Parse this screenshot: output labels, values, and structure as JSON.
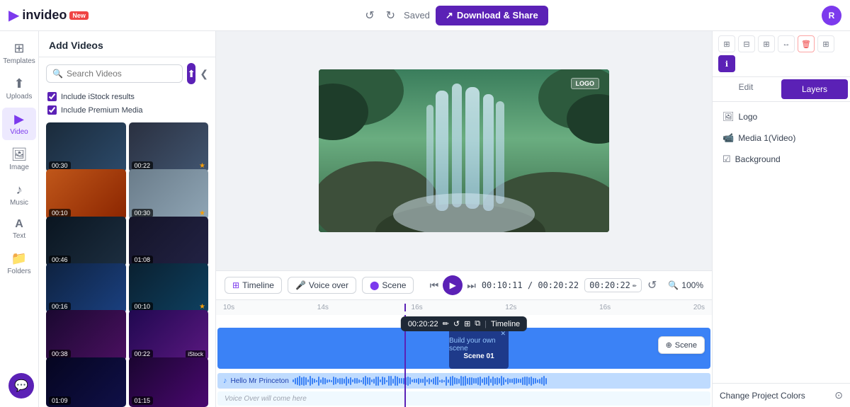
{
  "topbar": {
    "logo_text": "invideo",
    "new_badge": "New",
    "saved_label": "Saved",
    "download_btn": "Download & Share",
    "avatar_initial": "R"
  },
  "left_sidebar": {
    "items": [
      {
        "id": "templates",
        "label": "Templates",
        "icon": "⊞",
        "active": false
      },
      {
        "id": "uploads",
        "label": "Uploads",
        "icon": "⬆",
        "active": false
      },
      {
        "id": "video",
        "label": "Video",
        "icon": "▶",
        "active": true
      },
      {
        "id": "image",
        "label": "Image",
        "icon": "🖼",
        "active": false
      },
      {
        "id": "music",
        "label": "Music",
        "icon": "♪",
        "active": false
      },
      {
        "id": "text",
        "label": "Text",
        "icon": "A",
        "active": false
      },
      {
        "id": "folders",
        "label": "Folders",
        "icon": "📁",
        "active": false
      },
      {
        "id": "more",
        "label": "",
        "icon": "⌄",
        "active": false
      }
    ]
  },
  "panel": {
    "title": "Add Videos",
    "search_placeholder": "Search Videos",
    "upload_icon": "⬆",
    "collapse_icon": "❮",
    "checkboxes": [
      {
        "id": "istock",
        "label": "Include iStock results",
        "checked": true
      },
      {
        "id": "premium",
        "label": "Include Premium Media",
        "checked": true
      }
    ],
    "thumbs": [
      {
        "duration": "00:30",
        "star": false,
        "istock": false,
        "color1": "#2c3e50",
        "color2": "#4a6fa5"
      },
      {
        "duration": "00:22",
        "star": true,
        "istock": false,
        "color1": "#34495e",
        "color2": "#5a7a9a"
      },
      {
        "duration": "00:10",
        "star": false,
        "istock": false,
        "color1": "#e67e22",
        "color2": "#c0392b"
      },
      {
        "duration": "00:30",
        "star": true,
        "istock": false,
        "color1": "#7f8c8d",
        "color2": "#b0c4de"
      },
      {
        "duration": "00:46",
        "star": false,
        "istock": false,
        "color1": "#1a252f",
        "color2": "#2c3e50"
      },
      {
        "duration": "01:08",
        "star": false,
        "istock": false,
        "color1": "#1c1c2e",
        "color2": "#2d2d44"
      },
      {
        "duration": "00:16",
        "star": false,
        "istock": false,
        "color1": "#1a3a5c",
        "color2": "#2e6da4"
      },
      {
        "duration": "00:10",
        "star": true,
        "istock": false,
        "color1": "#2c3e50",
        "color2": "#16a085"
      },
      {
        "duration": "00:38",
        "star": false,
        "istock": false,
        "color1": "#1a0533",
        "color2": "#6c3483"
      },
      {
        "duration": "00:22",
        "star": false,
        "istock": true,
        "color1": "#2d1b69",
        "color2": "#6c3483"
      },
      {
        "duration": "01:09",
        "star": false,
        "istock": false,
        "color1": "#0a0a2e",
        "color2": "#1a1a5e"
      },
      {
        "duration": "01:15",
        "star": false,
        "istock": false,
        "color1": "#2d0a4e",
        "color2": "#6b21a8"
      }
    ]
  },
  "canvas": {
    "logo_watermark": "LOGO",
    "time_current": "00:10:11",
    "time_total": "00:20:22",
    "time_input": "00:20:22",
    "zoom": "100%",
    "timeline_btn": "Timeline",
    "voiceover_btn": "Voice over",
    "scene_btn": "Scene"
  },
  "timeline": {
    "ruler_labels": [
      "10s",
      "14s",
      "16s",
      "12s",
      "16s",
      "20s"
    ],
    "scene_popup": {
      "time": "00:20:22",
      "icons": [
        "✏",
        "↺",
        "⊞",
        "⧉",
        "Timeline"
      ]
    },
    "scene_block": {
      "label": "Build your own scene",
      "name": "Scene 01"
    },
    "audio_label": "Hello Mr Princeton",
    "voiceover_placeholder": "Voice Over will come here",
    "add_scene_btn": "Scene"
  },
  "right_panel": {
    "tools": [
      "⊞",
      "⊟",
      "⊞",
      "↔",
      "🗑",
      "⊞",
      "ℹ"
    ],
    "tabs": [
      {
        "label": "Edit",
        "active": false
      },
      {
        "label": "Layers",
        "active": true
      }
    ],
    "layers": [
      {
        "id": "logo",
        "icon": "🖼",
        "label": "Logo"
      },
      {
        "id": "media1",
        "icon": "📹",
        "label": "Media 1(Video)"
      },
      {
        "id": "background",
        "icon": "☑",
        "label": "Background"
      }
    ],
    "change_colors": "Change Project Colors",
    "color_wheel_icon": "⊙"
  },
  "chat_btn": "💬"
}
